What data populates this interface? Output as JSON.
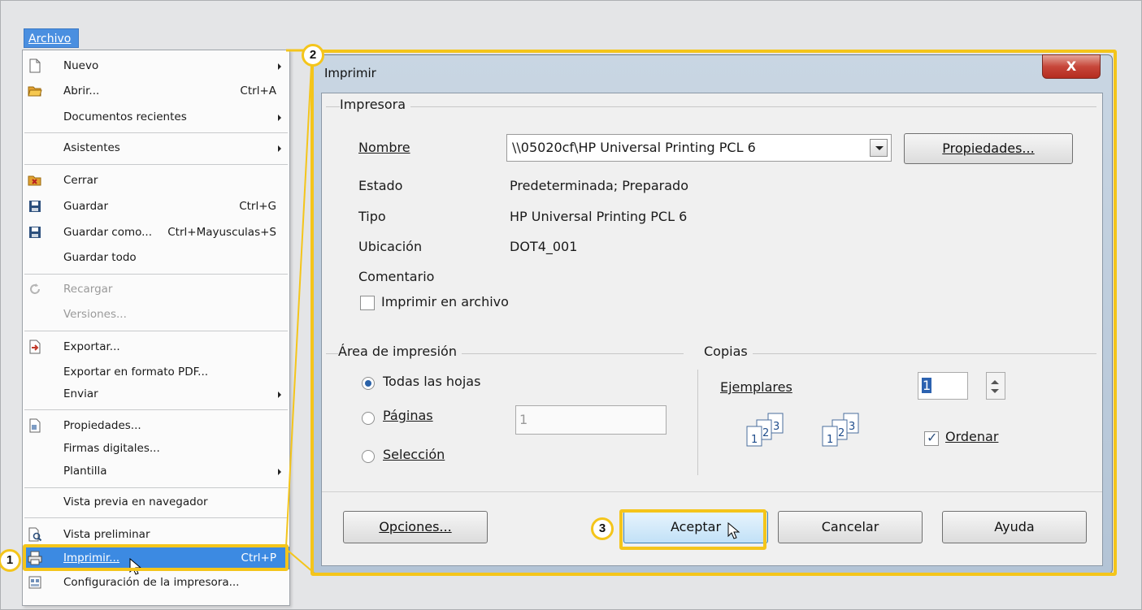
{
  "menubar": {
    "archivo": "Archivo"
  },
  "menu": {
    "items": [
      {
        "label": "Nuevo",
        "shortcut": "",
        "submenu": true,
        "icon": "new-doc-icon"
      },
      {
        "label": "Abrir...",
        "shortcut": "Ctrl+A",
        "submenu": false,
        "icon": "open-folder-icon"
      },
      {
        "label": "Documentos recientes",
        "shortcut": "",
        "submenu": true,
        "icon": ""
      },
      {
        "label": "Asistentes",
        "shortcut": "",
        "submenu": true,
        "icon": ""
      },
      {
        "label": "Cerrar",
        "shortcut": "",
        "submenu": false,
        "icon": "close-folder-icon"
      },
      {
        "label": "Guardar",
        "shortcut": "Ctrl+G",
        "submenu": false,
        "icon": "save-icon"
      },
      {
        "label": "Guardar como...",
        "shortcut": "Ctrl+Mayusculas+S",
        "submenu": false,
        "icon": "save-as-icon"
      },
      {
        "label": "Guardar todo",
        "shortcut": "",
        "submenu": false,
        "icon": ""
      },
      {
        "label": "Recargar",
        "shortcut": "",
        "submenu": false,
        "icon": "reload-icon",
        "disabled": true
      },
      {
        "label": "Versiones...",
        "shortcut": "",
        "submenu": false,
        "icon": "",
        "disabled": true
      },
      {
        "label": "Exportar...",
        "shortcut": "",
        "submenu": false,
        "icon": "export-icon"
      },
      {
        "label": "Exportar en formato PDF...",
        "shortcut": "",
        "submenu": false,
        "icon": ""
      },
      {
        "label": "Enviar",
        "shortcut": "",
        "submenu": true,
        "icon": ""
      },
      {
        "label": "Propiedades...",
        "shortcut": "",
        "submenu": false,
        "icon": "properties-icon"
      },
      {
        "label": "Firmas digitales...",
        "shortcut": "",
        "submenu": false,
        "icon": ""
      },
      {
        "label": "Plantilla",
        "shortcut": "",
        "submenu": true,
        "icon": ""
      },
      {
        "label": "Vista previa en navegador",
        "shortcut": "",
        "submenu": false,
        "icon": ""
      },
      {
        "label": "Vista preliminar",
        "shortcut": "",
        "submenu": false,
        "icon": "print-preview-icon"
      },
      {
        "label": "Imprimir...",
        "shortcut": "Ctrl+P",
        "submenu": false,
        "icon": "printer-icon",
        "selected": true
      },
      {
        "label": "Configuración de la impresora...",
        "shortcut": "",
        "submenu": false,
        "icon": "printer-settings-icon"
      }
    ]
  },
  "dialog": {
    "title": "Imprimir",
    "close_glyph": "X",
    "printer": {
      "group": "Impresora",
      "name_label": "Nombre",
      "name_value": "\\\\05020cf\\HP Universal Printing PCL 6",
      "properties_button": "Propiedades...",
      "estado_label": "Estado",
      "estado_value": "Predeterminada; Preparado",
      "tipo_label": "Tipo",
      "tipo_value": "HP Universal Printing PCL 6",
      "ubicacion_label": "Ubicación",
      "ubicacion_value": "DOT4_001",
      "comentario_label": "Comentario",
      "print_to_file": "Imprimir en archivo"
    },
    "area": {
      "group": "Área de impresión",
      "all_sheets": "Todas las hojas",
      "pages": "Páginas",
      "pages_value": "1",
      "selection": "Selección"
    },
    "copies": {
      "group": "Copias",
      "count_label": "Ejemplares",
      "count_value": "1",
      "collate": "Ordenar",
      "page_numbers": [
        "1",
        "2",
        "3"
      ]
    },
    "buttons": {
      "options": "Opciones...",
      "ok": "Aceptar",
      "cancel": "Cancelar",
      "help": "Ayuda"
    }
  },
  "callouts": [
    "1",
    "2",
    "3"
  ],
  "colors": {
    "highlight": "#f4c51b",
    "menu_selected": "#3c8ae2",
    "close_button": "#c7473a"
  }
}
